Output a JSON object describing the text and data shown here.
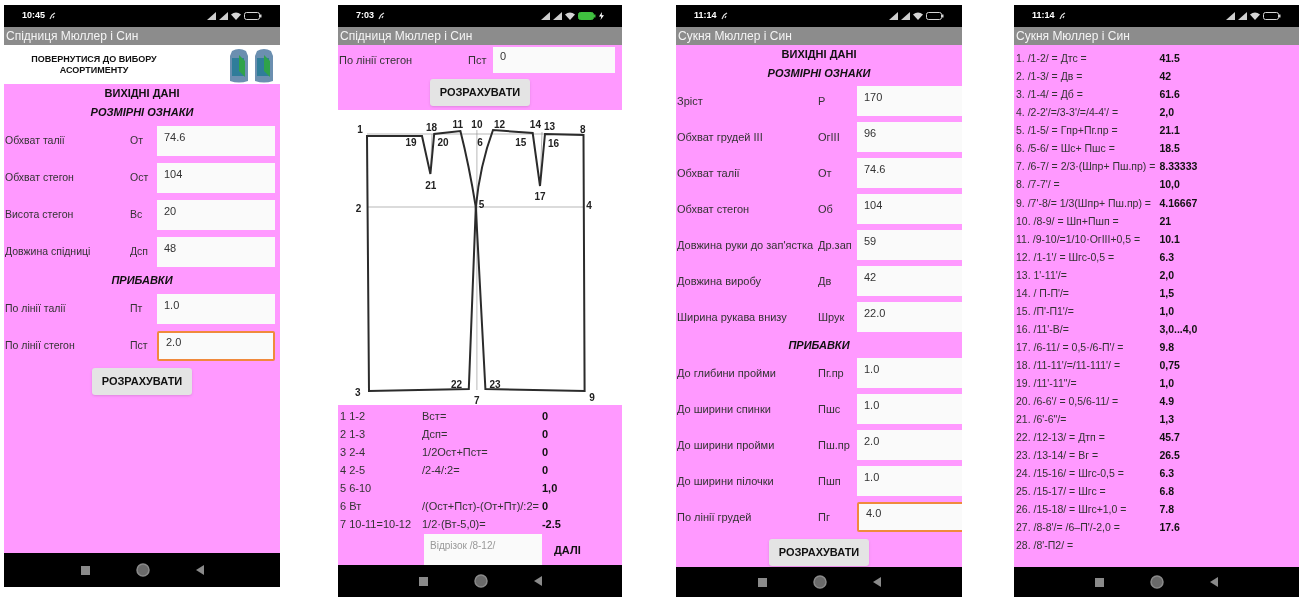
{
  "phones": [
    {
      "status_time": "10:45",
      "charging": false,
      "app_title": "Спідниця Мюллер і Син",
      "blocks": [
        {
          "kind": "back_header",
          "text": "ПОВЕРНУТИСЯ ДО ВИБОРУ АСОРТИМЕНТУ"
        },
        {
          "kind": "heading",
          "text": "ВИХІДНІ ДАНІ"
        },
        {
          "kind": "subheading",
          "text": "РОЗМІРНІ ОЗНАКИ"
        },
        {
          "kind": "field",
          "label": "Обхват талії",
          "abbr": "От",
          "value": "74.6",
          "focused": false
        },
        {
          "kind": "field",
          "label": "Обхват стегон",
          "abbr": "Ост",
          "value": "104",
          "focused": false
        },
        {
          "kind": "field",
          "label": "Висота стегон",
          "abbr": "Вс",
          "value": "20",
          "focused": false
        },
        {
          "kind": "field",
          "label": "Довжина спідниці",
          "abbr": "Дсп",
          "value": "48",
          "focused": false
        },
        {
          "kind": "subheading",
          "text": "ПРИБАВКИ"
        },
        {
          "kind": "field",
          "label": "По лінії талії",
          "abbr": "Пт",
          "value": "1.0",
          "focused": false
        },
        {
          "kind": "field",
          "label": "По лінії стегон",
          "abbr": "Пст",
          "value": "2.0",
          "focused": true
        },
        {
          "kind": "button",
          "text": "РОЗРАХУВАТИ"
        }
      ]
    },
    {
      "status_time": "7:03",
      "charging": true,
      "app_title": "Спідниця Мюллер і Син",
      "blocks": [
        {
          "kind": "field",
          "label": "По лінії стегон",
          "abbr": "Пст",
          "value": "0",
          "focused": false
        },
        {
          "kind": "button",
          "text": "РОЗРАХУВАТИ"
        },
        {
          "kind": "pattern",
          "point_labels": [
            "1",
            "18",
            "11",
            "10",
            "12",
            "14",
            "13",
            "8",
            "19",
            "20",
            "6",
            "15",
            "16",
            "21",
            "17",
            "2",
            "5",
            "4",
            "3",
            "22",
            "23",
            "7",
            "9"
          ]
        },
        {
          "kind": "calc",
          "step": "1 1-2",
          "formula": "Вст=",
          "value": "0"
        },
        {
          "kind": "calc",
          "step": "2 1-3",
          "formula": "Дсп=",
          "value": "0"
        },
        {
          "kind": "calc",
          "step": "3 2-4",
          "formula": "1/2Ост+Пст=",
          "value": "0"
        },
        {
          "kind": "calc",
          "step": "4 2-5",
          "formula": "/2-4/:2=",
          "value": "0"
        },
        {
          "kind": "calc",
          "step": "5 6-10",
          "value": "1,0"
        },
        {
          "kind": "calc",
          "step": "6 Вт",
          "formula": "/(Ост+Пст)-(От+Пт)/:2=",
          "value": "0"
        },
        {
          "kind": "calc",
          "step": "7 10-11=10-12",
          "formula": "1/2·(Вт-5,0)=",
          "value": "-2.5"
        },
        {
          "kind": "next",
          "placeholder": "Відрізок /8-12/",
          "button": "ДАЛІ"
        }
      ]
    },
    {
      "status_time": "11:14",
      "charging": false,
      "app_title": "Сукня Мюллер і Син",
      "blocks": [
        {
          "kind": "heading",
          "text": "ВИХІДНІ ДАНІ"
        },
        {
          "kind": "subheading",
          "text": "РОЗМІРНІ ОЗНАКИ"
        },
        {
          "kind": "field",
          "label": "Зріст",
          "abbr": "Р",
          "value": "170",
          "focused": false
        },
        {
          "kind": "field",
          "label": "Обхват грудей III",
          "abbr": "ОгIII",
          "value": "96",
          "focused": false
        },
        {
          "kind": "field",
          "label": "Обхват талії",
          "abbr": "От",
          "value": "74.6",
          "focused": false
        },
        {
          "kind": "field",
          "label": "Обхват стегон",
          "abbr": "Об",
          "value": "104",
          "focused": false
        },
        {
          "kind": "field",
          "label": "Довжина руки до зап'ястка",
          "abbr": "Др.зап",
          "value": "59",
          "focused": false
        },
        {
          "kind": "field",
          "label": "Довжина виробу",
          "abbr": "Дв",
          "value": "42",
          "focused": false
        },
        {
          "kind": "field",
          "label": "Ширина рукава внизу",
          "abbr": "Шрук",
          "value": "22.0",
          "focused": false
        },
        {
          "kind": "subheading",
          "text": "ПРИБАВКИ"
        },
        {
          "kind": "field",
          "label": "До глибини пройми",
          "abbr": "Пг.пр",
          "value": "1.0",
          "focused": false
        },
        {
          "kind": "field",
          "label": "До ширини спинки",
          "abbr": "Пшс",
          "value": "1.0",
          "focused": false
        },
        {
          "kind": "field",
          "label": "До ширини пройми",
          "abbr": "Пш.пр",
          "value": "2.0",
          "focused": false
        },
        {
          "kind": "field",
          "label": "До ширини пілочки",
          "abbr": "Пшп",
          "value": "1.0",
          "focused": false
        },
        {
          "kind": "field",
          "label": "По лінії грудей",
          "abbr": "Пг",
          "value": "4.0",
          "focused": true
        },
        {
          "kind": "button",
          "text": "РОЗРАХУВАТИ"
        }
      ]
    },
    {
      "status_time": "11:14",
      "charging": false,
      "app_title": "Сукня Мюллер і Син",
      "blocks": [
        {
          "kind": "result",
          "formula": "1. /1-2/ = Дтс =",
          "value": "41.5"
        },
        {
          "kind": "result",
          "formula": "2. /1-3/ = Дв =",
          "value": "42"
        },
        {
          "kind": "result",
          "formula": "3. /1-4/ = Дб =",
          "value": "61.6"
        },
        {
          "kind": "result",
          "formula": "4. /2-2'/=/3-3'/=/4-4'/ =",
          "value": "2,0"
        },
        {
          "kind": "result",
          "formula": "5. /1-5/ = Гпр+Пг.пр =",
          "value": "21.1"
        },
        {
          "kind": "result",
          "formula": "6. /5-6/ = Шс+ Пшс =",
          "value": "18.5"
        },
        {
          "kind": "result",
          "formula": "7. /6-7/ = 2/3·(Шпр+ Пш.пр) =",
          "value": "8.33333"
        },
        {
          "kind": "result",
          "formula": "8. /7-7'/ =",
          "value": "10,0"
        },
        {
          "kind": "result",
          "formula": "9. /7'-8/= 1/3(Шпр+ Пш.пр) =",
          "value": "4.16667"
        },
        {
          "kind": "result",
          "formula": "10. /8-9/ = Шп+Пшп =",
          "value": "21"
        },
        {
          "kind": "result",
          "formula": "11. /9-10/=1/10·ОгIII+0,5 =",
          "value": "10.1"
        },
        {
          "kind": "result",
          "formula": "12. /1-1'/ = Шгс-0,5 =",
          "value": "6.3"
        },
        {
          "kind": "result",
          "formula": "13. 1'-11'/=",
          "value": "2,0"
        },
        {
          "kind": "result",
          "formula": "14. / П-П'/=",
          "value": "1,5"
        },
        {
          "kind": "result",
          "formula": "15. /П'-П1'/=",
          "value": "1,0"
        },
        {
          "kind": "result",
          "formula": "16. /11'-В/=",
          "value": "3,0...4,0"
        },
        {
          "kind": "result",
          "formula": "17. /6-11/ = 0,5·/6-П'/ =",
          "value": "9.8"
        },
        {
          "kind": "result",
          "formula": "18. /11-11'/=/11-111'/ =",
          "value": "0,75"
        },
        {
          "kind": "result",
          "formula": "19. /11'-11\"/=",
          "value": "1,0"
        },
        {
          "kind": "result",
          "formula": "20. /6-6'/ = 0,5/6-11/ =",
          "value": "4.9"
        },
        {
          "kind": "result",
          "formula": "21. /6'-6\"/=",
          "value": "1,3"
        },
        {
          "kind": "result",
          "formula": "22. /12-13/ = Дтп =",
          "value": "45.7"
        },
        {
          "kind": "result",
          "formula": "23. /13-14/ = Вг =",
          "value": "26.5"
        },
        {
          "kind": "result",
          "formula": "24. /15-16/ = Шгс-0,5 =",
          "value": "6.3"
        },
        {
          "kind": "result",
          "formula": "25. /15-17/ = Шгс =",
          "value": "6.8"
        },
        {
          "kind": "result",
          "formula": "26. /15-18/ = Шгс+1,0 =",
          "value": "7.8"
        },
        {
          "kind": "result",
          "formula": "27. /8-8'/= /6–П'/-2,0 =",
          "value": "17.6"
        },
        {
          "kind": "result",
          "formula": "28. /8'-П2/ ="
        }
      ]
    }
  ]
}
